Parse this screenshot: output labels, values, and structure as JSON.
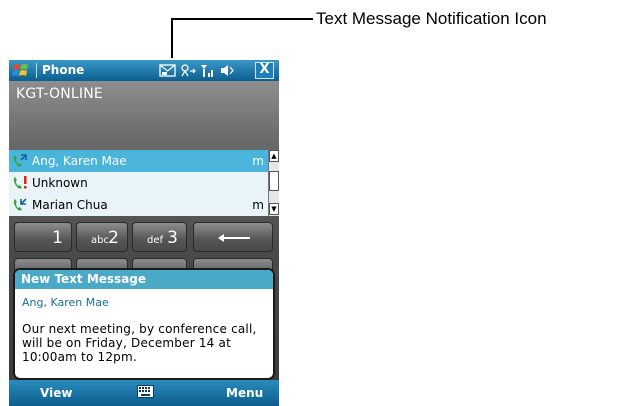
{
  "callout": {
    "label": "Text Message Notification Icon"
  },
  "titlebar": {
    "app_title": "Phone",
    "icons": [
      "start-menu-icon",
      "text-message-notification-icon",
      "connectivity-icon",
      "signal-icon",
      "volume-icon"
    ],
    "close_label": "X"
  },
  "operator": "KGT-ONLINE",
  "call_list": [
    {
      "name": "Ang, Karen Mae",
      "type": "m",
      "icon": "outgoing-call-icon",
      "selected": true
    },
    {
      "name": "Unknown",
      "type": "",
      "icon": "missed-call-icon",
      "selected": false
    },
    {
      "name": "Marian Chua",
      "type": "m",
      "icon": "incoming-call-icon",
      "selected": false
    }
  ],
  "keypad": [
    {
      "digit": "1",
      "letters": ""
    },
    {
      "digit": "2",
      "letters": "abc"
    },
    {
      "digit": "3",
      "letters": "def"
    },
    {
      "digit": "←",
      "letters": ""
    }
  ],
  "notification": {
    "header": "New Text Message",
    "sender": "Ang, Karen Mae",
    "body": "Our next meeting, by conference call, will be on Friday, December 14 at 10:00am to 12pm."
  },
  "softkeys": {
    "left": "View",
    "right": "Menu"
  },
  "colors": {
    "accent": "#0b5e90",
    "selection": "#4ab4da",
    "notif_header": "#4aa9c7"
  }
}
